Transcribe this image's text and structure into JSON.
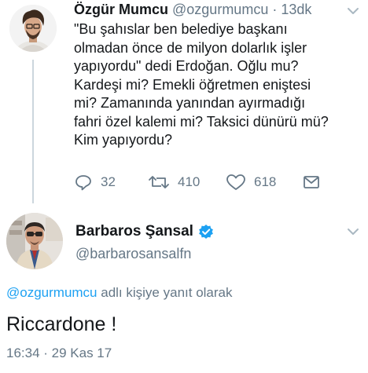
{
  "tweet1": {
    "name": "Özgür Mumcu",
    "handle": "@ozgurmumcu",
    "separator": "·",
    "time": "13dk",
    "text_lines": [
      "\"Bu şahıslar ben belediye başkanı",
      "olmadan önce de milyon dolarlık işler",
      "yapıyordu\" dedi Erdoğan. Oğlu mu?",
      "Kardeşi mi? Emekli öğretmen eniştesi",
      "mi? Zamanında yanından ayırmadığı",
      "fahri özel kalemi mi? Taksici dünürü mü?",
      "Kim yapıyordu?"
    ],
    "replies": "32",
    "retweets": "410",
    "likes": "618"
  },
  "tweet2": {
    "name": "Barbaros Şansal",
    "handle": "@barbarosansalfn",
    "reply_mention": "@ozgurmumcu",
    "reply_suffix": "adlı kişiye yanıt olarak",
    "text": "Riccardone !",
    "timestamp": "16:34 · 29 Kas 17"
  },
  "colors": {
    "text": "#14171a",
    "secondary": "#657786",
    "accent": "#1da1f2",
    "thread_line": "#ccd6dd"
  },
  "icons": [
    "reply-icon",
    "retweet-icon",
    "like-icon",
    "dm-icon",
    "chevron-down-icon",
    "verified-icon"
  ]
}
